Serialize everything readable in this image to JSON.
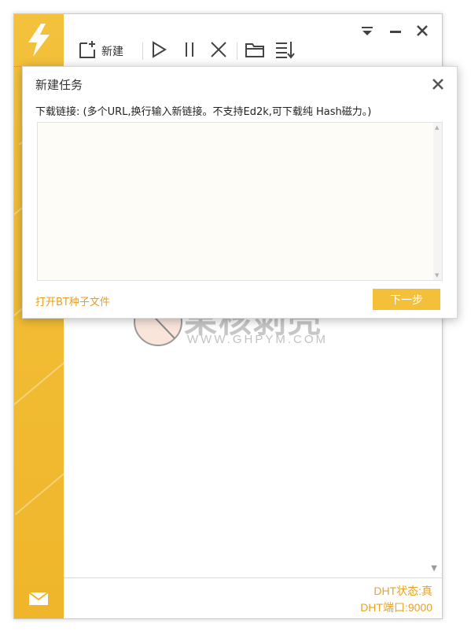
{
  "toolbar": {
    "new_label": "新建",
    "icons": [
      "new-task-icon",
      "start-icon",
      "pause-icon",
      "delete-icon",
      "open-folder-icon",
      "sort-icon"
    ]
  },
  "window_controls": [
    "dropdown-menu-icon",
    "minimize-icon",
    "close-icon"
  ],
  "dialog": {
    "title": "新建任务",
    "hint": "下载链接: (多个URL,换行输入新链接。不支持Ed2k,可下载纯 Hash磁力。)",
    "input_value": "",
    "open_bt_link": "打开BT种子文件",
    "next_button": "下一步"
  },
  "status": {
    "dht_state": "DHT状态:真",
    "dht_port": "DHT端口:9000"
  },
  "watermark": {
    "title": "果核剥壳",
    "url": "WWW.GHPYM.COM"
  },
  "colors": {
    "accent": "#f0b72e",
    "status_text": "#e6a326",
    "next_button_bg": "#f4c03a"
  }
}
